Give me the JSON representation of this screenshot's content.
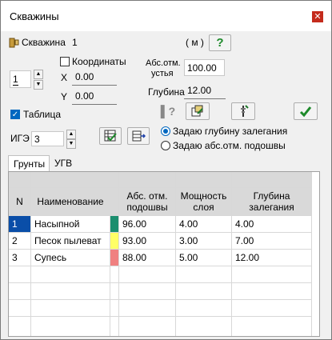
{
  "window": {
    "title": "Скважины",
    "close_icon": "close-icon"
  },
  "well": {
    "label": "Скважина",
    "number": "1",
    "units": "( м )",
    "spin_value": "1"
  },
  "coords": {
    "checkbox_label": "Координаты",
    "x_label": "X",
    "x_value": "0.00",
    "y_label": "Y",
    "y_value": "0.00"
  },
  "elevation": {
    "label_line1": "Абс.отм.",
    "label_line2": "устья",
    "value": "100.00",
    "depth_label": "Глубина",
    "depth_value": "12.00"
  },
  "table_toggle": {
    "label": "Таблица",
    "checked": true
  },
  "ige": {
    "label": "ИГЭ",
    "value": "3"
  },
  "radios": {
    "option1": "Задаю глубину залегания",
    "option2": "Задаю абс.отм. подошвы",
    "selected": "option1"
  },
  "tabs": [
    {
      "label": "Грунты"
    },
    {
      "label": "УГВ"
    }
  ],
  "grid": {
    "headers": {
      "n": "N",
      "name": "Наименование",
      "abs_line1": "Абс. отм.",
      "abs_line2": "подошвы",
      "thick_line1": "Мощность",
      "thick_line2": "слоя",
      "depth_line1": "Глубина",
      "depth_line2": "залегания"
    },
    "rows": [
      {
        "n": "1",
        "name": "Насыпной",
        "color": "#1b8e6e",
        "abs": "96.00",
        "thick": "4.00",
        "depth": "4.00"
      },
      {
        "n": "2",
        "name": "Песок пылеват",
        "color": "#ffff66",
        "abs": "93.00",
        "thick": "3.00",
        "depth": "7.00"
      },
      {
        "n": "3",
        "name": "Супесь",
        "color": "#f08080",
        "abs": "88.00",
        "thick": "5.00",
        "depth": "12.00"
      }
    ]
  },
  "colors": {
    "accent": "#0067c0",
    "selection": "#0a4ea8"
  }
}
